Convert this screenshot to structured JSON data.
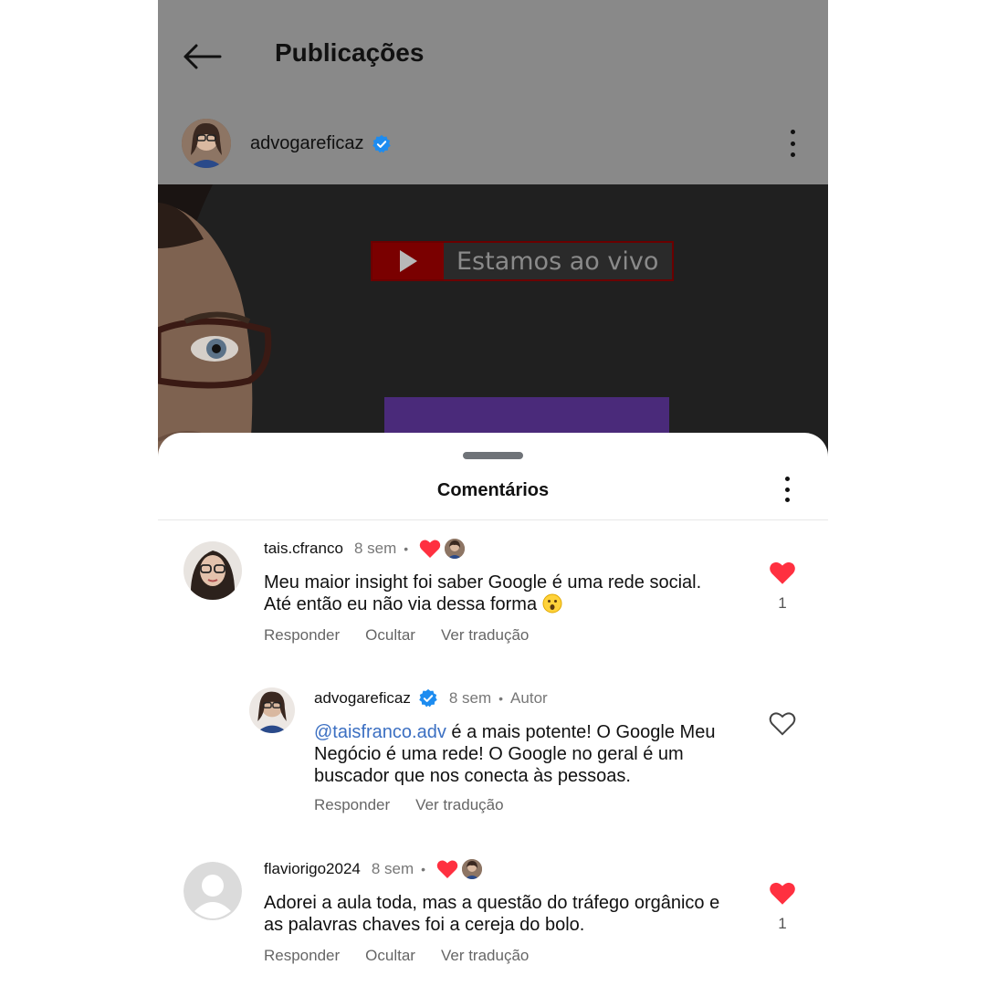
{
  "header": {
    "title": "Publicações"
  },
  "post": {
    "username": "advogareficaz",
    "live_label": "Estamos ao vivo"
  },
  "comments_sheet": {
    "title": "Comentários",
    "comments": [
      {
        "username": "tais.cfranco",
        "time": "8 sem",
        "dot": "•",
        "text_line1": "Meu maior insight  foi saber Google é uma rede social.",
        "text_line2": "Até então eu não via dessa forma",
        "actions": [
          "Responder",
          "Ocultar",
          "Ver tradução"
        ],
        "likes": "1"
      },
      {
        "username": "advogareficaz",
        "time": "8 sem",
        "dot": "•",
        "author_label": "Autor",
        "mention": "@taisfranco.adv",
        "text_after_mention": " é a mais potente! O Google Meu",
        "text_line2": "Negócio é uma rede! O Google no geral é um",
        "text_line3": "buscador que nos conecta às pessoas.",
        "actions": [
          "Responder",
          "Ver tradução"
        ]
      },
      {
        "username": "flaviorigo2024",
        "time": "8 sem",
        "dot": "•",
        "text_line1": "Adorei a aula toda, mas a questão do tráfego orgânico e",
        "text_line2": "as palavras chaves foi a cereja do bolo.",
        "actions": [
          "Responder",
          "Ocultar",
          "Ver tradução"
        ],
        "likes": "1"
      }
    ]
  },
  "colors": {
    "like_red": "#ff3040",
    "mention_blue": "#3b6fc2",
    "verified_blue": "#1d8cf0"
  }
}
